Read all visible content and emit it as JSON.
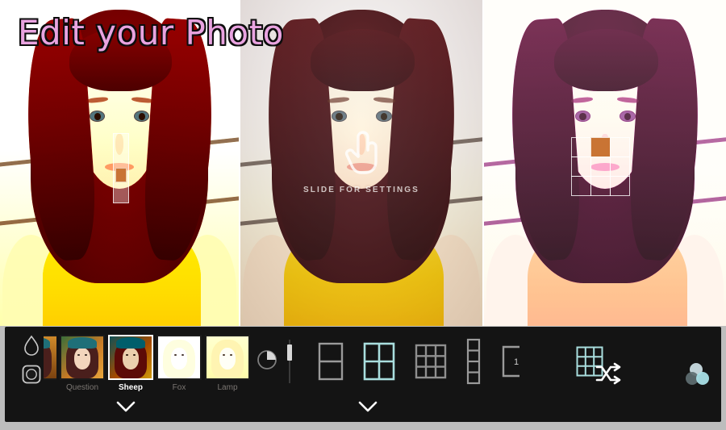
{
  "app": {
    "title": "Edit your Photo",
    "background_color": "#bdbdbd",
    "toolbar_color": "#141414",
    "accent_color": "#9ad6d6",
    "handle_color": "#c97434",
    "title_color": "#e9a3e0"
  },
  "photo_panels": [
    {
      "id": "panel-left",
      "name": "warm-filtered-photo",
      "filter_style": "warm / high saturation orange",
      "overlay": "vertical-slider",
      "slider_value_label": ""
    },
    {
      "id": "panel-center",
      "name": "natural-photo",
      "filter_style": "natural",
      "overlay": "slide-hint",
      "hint_text": "SLIDE FOR SETTINGS",
      "hint_icon": "hand-pointer-icon"
    },
    {
      "id": "panel-right",
      "name": "purple-duotone-photo",
      "filter_style": "magenta duotone",
      "overlay": "grid-3x3",
      "active_cell_index": 1
    }
  ],
  "toolbar": {
    "left_icons": [
      {
        "name": "droplet-icon",
        "label": "Blur"
      },
      {
        "name": "vignette-icon",
        "label": "Vignette"
      }
    ],
    "filters": [
      {
        "label": "",
        "selected": false,
        "clipped": true,
        "tone": "#c8771f"
      },
      {
        "label": "Question",
        "selected": false,
        "clipped": false,
        "tone": "#b5702a"
      },
      {
        "label": "Sheep",
        "selected": true,
        "clipped": false,
        "tone": "#7a3f33"
      },
      {
        "label": "Fox",
        "selected": false,
        "clipped": false,
        "tone": "#f6eaf0"
      },
      {
        "label": "Lamp",
        "selected": false,
        "clipped": false,
        "tone": "#efd79a"
      }
    ],
    "exposure_icon": {
      "name": "exposure-clock-icon",
      "label": "Exposure"
    },
    "layout_icons": [
      {
        "name": "layout-1x2-icon",
        "label": "1x2",
        "selected": false,
        "cols": 1,
        "rows": 2
      },
      {
        "name": "layout-2x2-icon",
        "label": "2x2",
        "selected": true,
        "cols": 2,
        "rows": 2
      },
      {
        "name": "layout-3x3-icon",
        "label": "3x3",
        "selected": false,
        "cols": 3,
        "rows": 3
      },
      {
        "name": "layout-1x4-icon",
        "label": "1x4",
        "selected": false,
        "cols": 1,
        "rows": 4
      },
      {
        "name": "layout-single-frame-icon",
        "label": "1",
        "selected": false,
        "badge": "1"
      },
      {
        "name": "layout-grid-3x3-teal-icon",
        "label": "3x3",
        "selected": true,
        "cols": 3,
        "rows": 3
      }
    ],
    "shuffle_icon": {
      "name": "shuffle-icon",
      "label": "Shuffle"
    },
    "color-mixer_icon": {
      "name": "color-circles-icon",
      "label": "Color Mixer"
    },
    "chevrons": [
      {
        "name": "chevron-down-filters",
        "label": "Collapse filters"
      },
      {
        "name": "chevron-down-layouts",
        "label": "Collapse layouts"
      }
    ]
  }
}
